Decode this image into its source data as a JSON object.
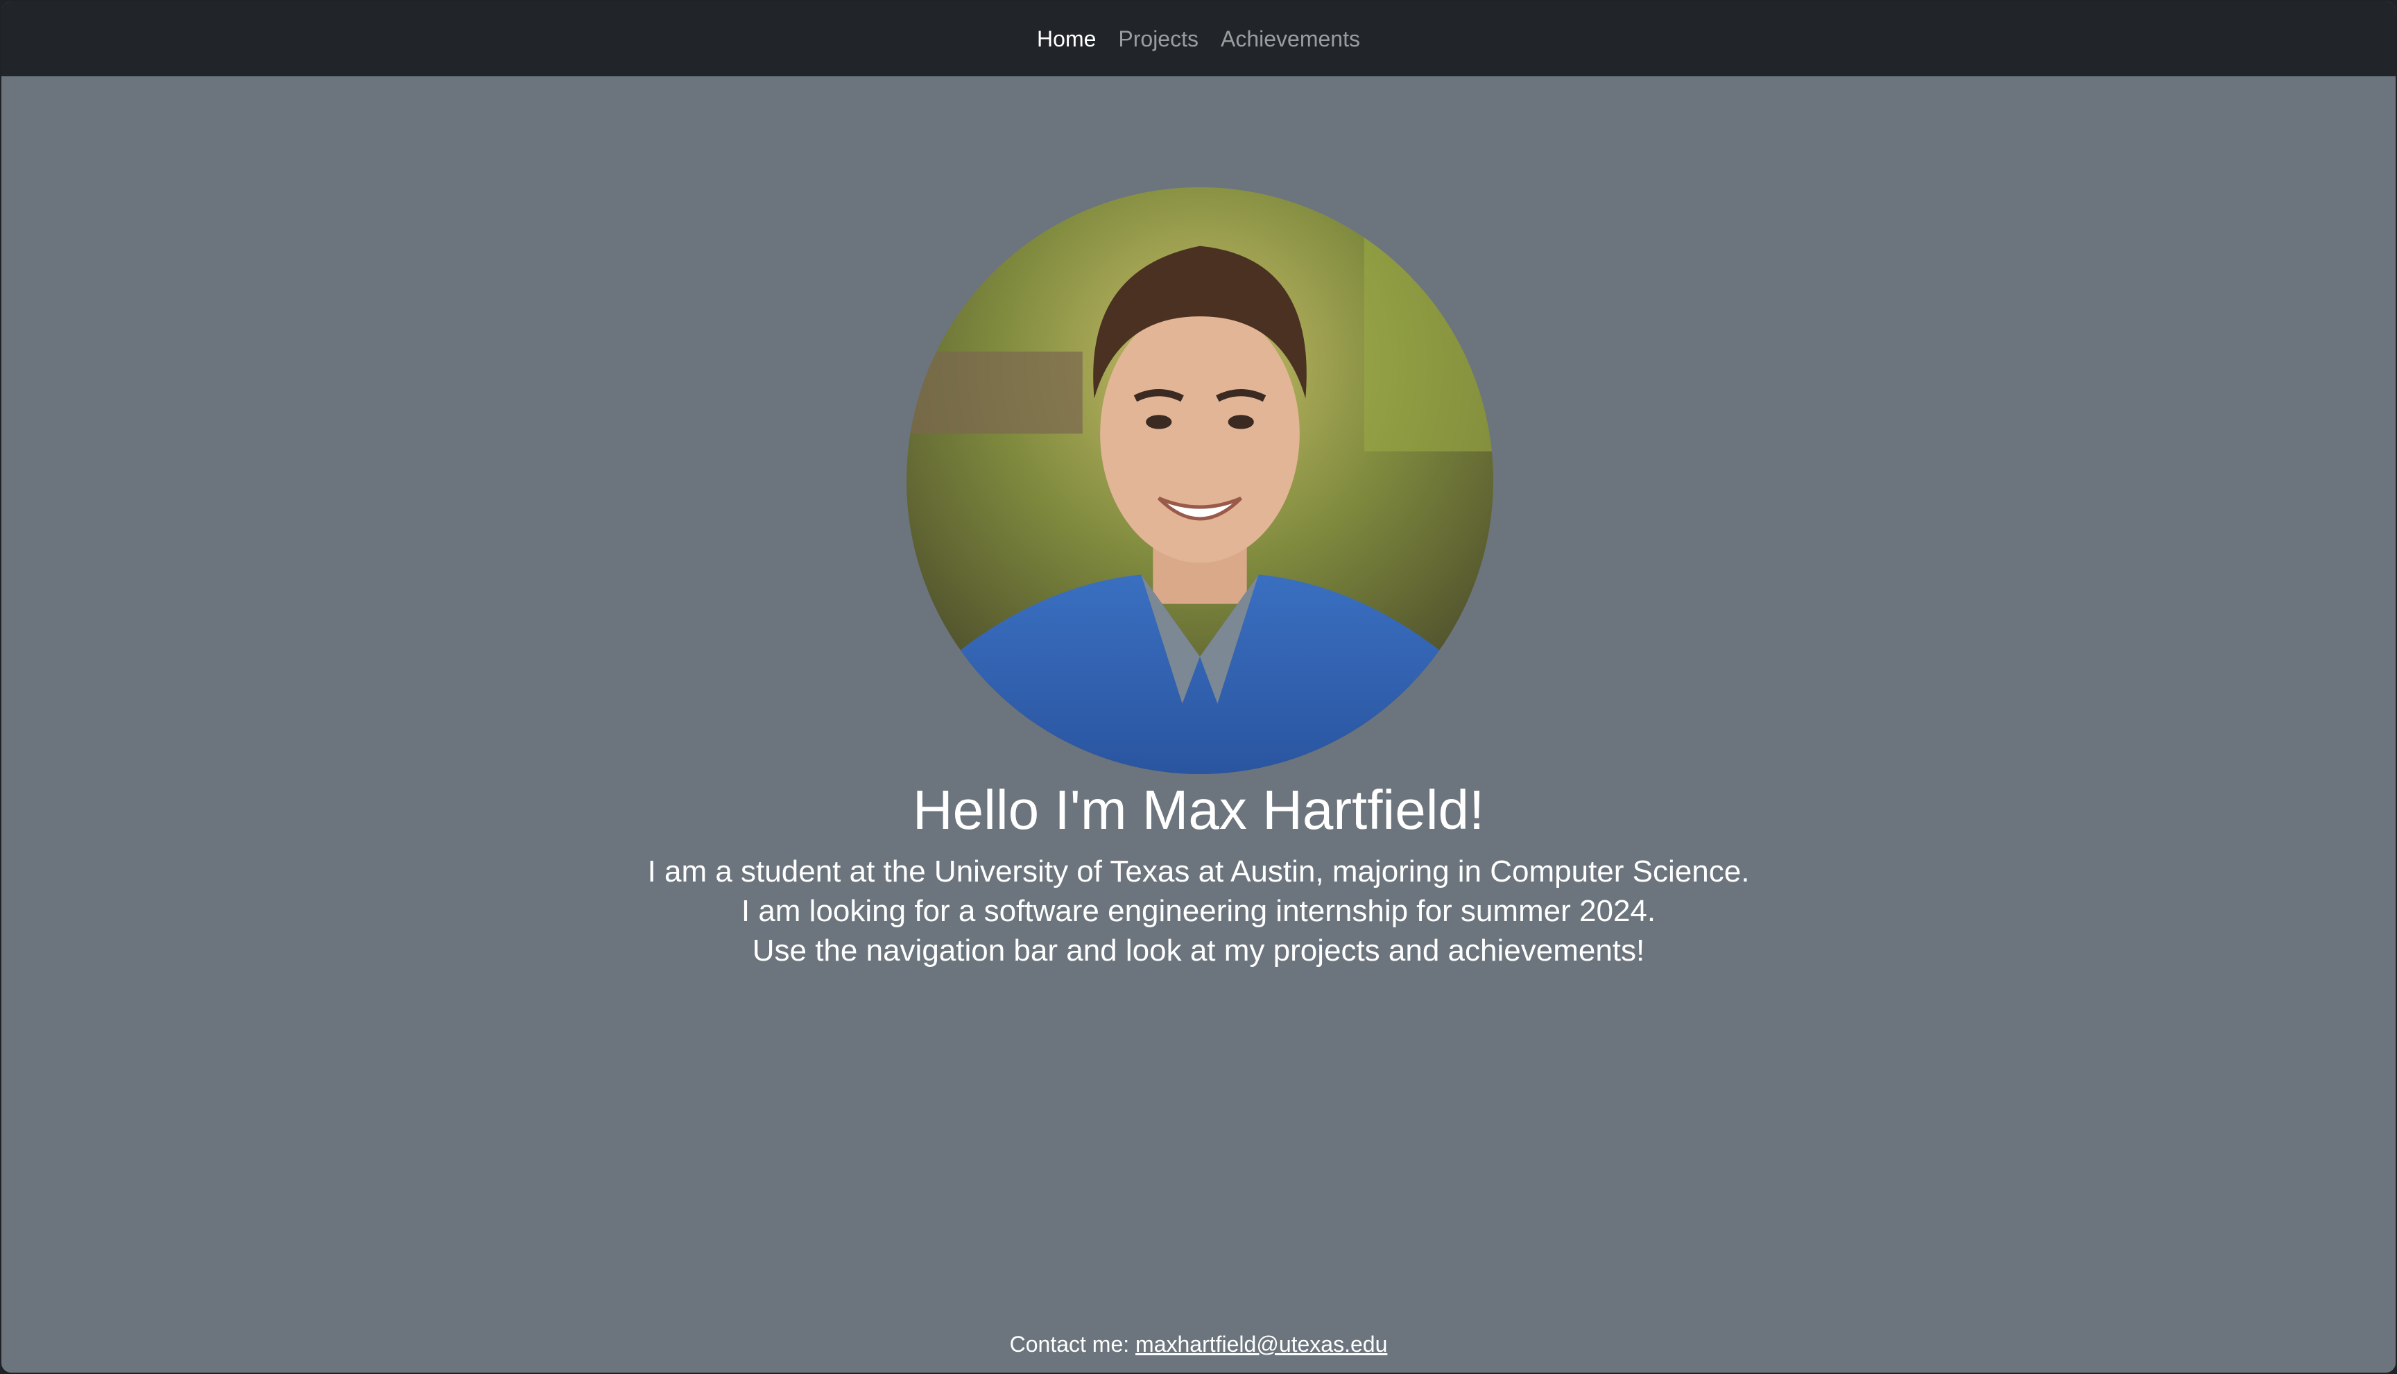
{
  "nav": {
    "items": [
      {
        "label": "Home",
        "active": true
      },
      {
        "label": "Projects",
        "active": false
      },
      {
        "label": "Achievements",
        "active": false
      }
    ]
  },
  "hero": {
    "headline": "Hello I'm Max Hartfield!",
    "lines": [
      "I am a student at the University of Texas at Austin, majoring in Computer Science.",
      "I am looking for a software engineering internship for summer 2024.",
      "Use the navigation bar and look at my projects and achievements!"
    ]
  },
  "footer": {
    "contact_label": "Contact me:",
    "email": "maxhartfield@utexas.edu"
  },
  "colors": {
    "navbar_bg": "#212529",
    "page_bg": "#6c757d",
    "text": "#ffffff",
    "nav_inactive": "rgba(255,255,255,0.55)"
  }
}
